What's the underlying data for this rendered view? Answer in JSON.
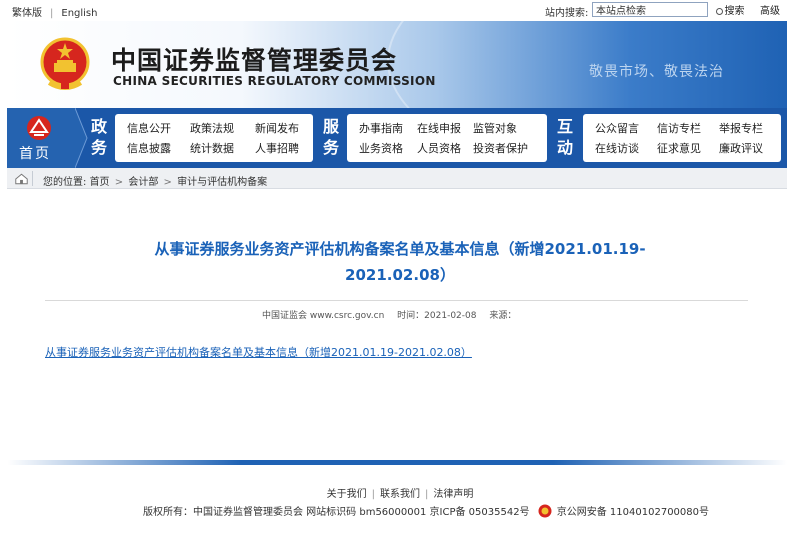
{
  "topbar": {
    "lang_traditional": "繁体版",
    "lang_separator": "|",
    "lang_english": "English",
    "search_label": "站内搜索:",
    "search_value": "本站点检索",
    "search_button": "搜索",
    "advanced_button": "高级"
  },
  "banner": {
    "title_cn": "中国证券监督管理委员会",
    "title_en": "CHINA SECURITIES REGULATORY COMMISSION",
    "slogan": "敬畏市场、敬畏法治"
  },
  "nav": {
    "home_label": "首页",
    "groups": [
      {
        "category": [
          "政",
          "务"
        ],
        "items": [
          "信息公开",
          "政策法规",
          "新闻发布",
          "信息披露",
          "统计数据",
          "人事招聘"
        ]
      },
      {
        "category": [
          "服",
          "务"
        ],
        "items": [
          "办事指南",
          "在线申报",
          "监管对象",
          "业务资格",
          "人员资格",
          "投资者保护"
        ]
      },
      {
        "category": [
          "互",
          "动"
        ],
        "items": [
          "公众留言",
          "信访专栏",
          "举报专栏",
          "在线访谈",
          "征求意见",
          "廉政评议"
        ]
      }
    ]
  },
  "breadcrumb": {
    "prefix": "您的位置:",
    "items": [
      "首页",
      "会计部",
      "审计与评估机构备案"
    ],
    "arrow": ">"
  },
  "article": {
    "title_line1": "从事证券服务业务资产评估机构备案名单及基本信息（新增2021.01.19-",
    "title_line2": "2021.02.08）",
    "source": "中国证监会 www.csrc.gov.cn",
    "time": "时间：2021-02-08",
    "origin": "来源：",
    "attachment_link": "从事证券服务业务资产评估机构备案名单及基本信息（新增2021.01.19-2021.02.08）"
  },
  "footer": {
    "links": [
      "关于我们",
      "联系我们",
      "法律声明"
    ],
    "link_separator": "|",
    "copyright": "版权所有：中国证券监督管理委员会 网站标识码 bm56000001 京ICP备 05035542号",
    "police_record": "京公网安备 11040102700080号"
  },
  "colors": {
    "nav_blue": "#1b57a8",
    "title_blue": "#1a62b8",
    "emblem_red": "#d6261e",
    "emblem_gold": "#f2c230"
  }
}
